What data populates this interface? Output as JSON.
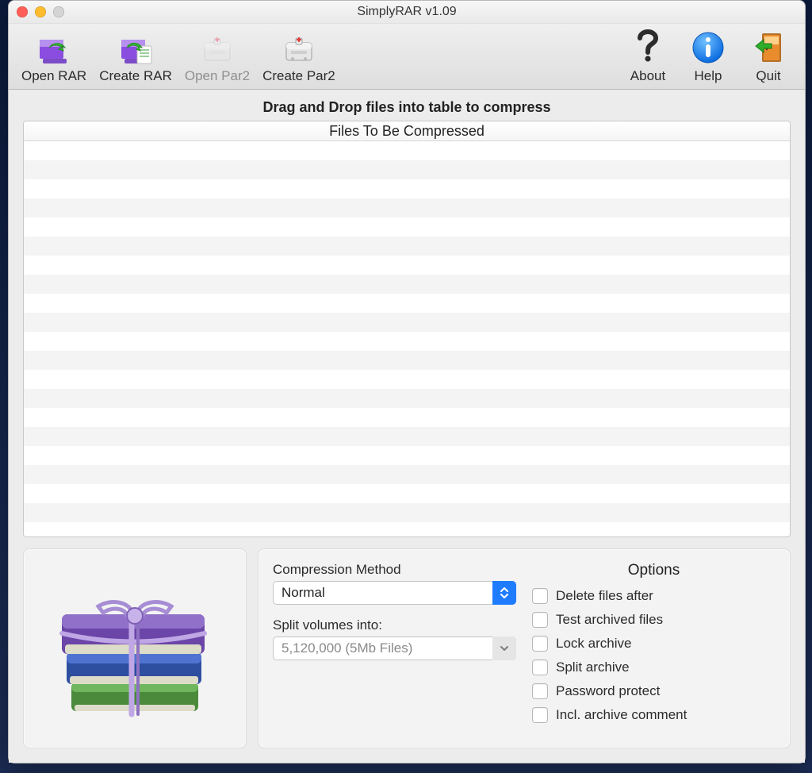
{
  "window": {
    "title": "SimplyRAR v1.09"
  },
  "toolbar": {
    "open_rar": "Open RAR",
    "create_rar": "Create RAR",
    "open_par2": "Open Par2",
    "create_par2": "Create Par2",
    "about": "About",
    "help": "Help",
    "quit": "Quit"
  },
  "main": {
    "hint": "Drag and Drop files into table to compress",
    "table_header": "Files To Be Compressed"
  },
  "settings": {
    "compression_label": "Compression Method",
    "compression_value": "Normal",
    "split_label": "Split volumes into:",
    "split_value": "5,120,000 (5Mb Files)"
  },
  "options": {
    "title": "Options",
    "items": [
      "Delete files after",
      "Test archived files",
      "Lock archive",
      "Split archive",
      "Password protect",
      "Incl. archive comment"
    ]
  },
  "icons": {
    "open_rar": "open-rar-icon",
    "create_rar": "create-rar-icon",
    "open_par2": "open-par2-icon",
    "create_par2": "create-par2-icon",
    "about": "question-icon",
    "help": "info-icon",
    "quit": "quit-icon",
    "logo": "books-icon"
  }
}
